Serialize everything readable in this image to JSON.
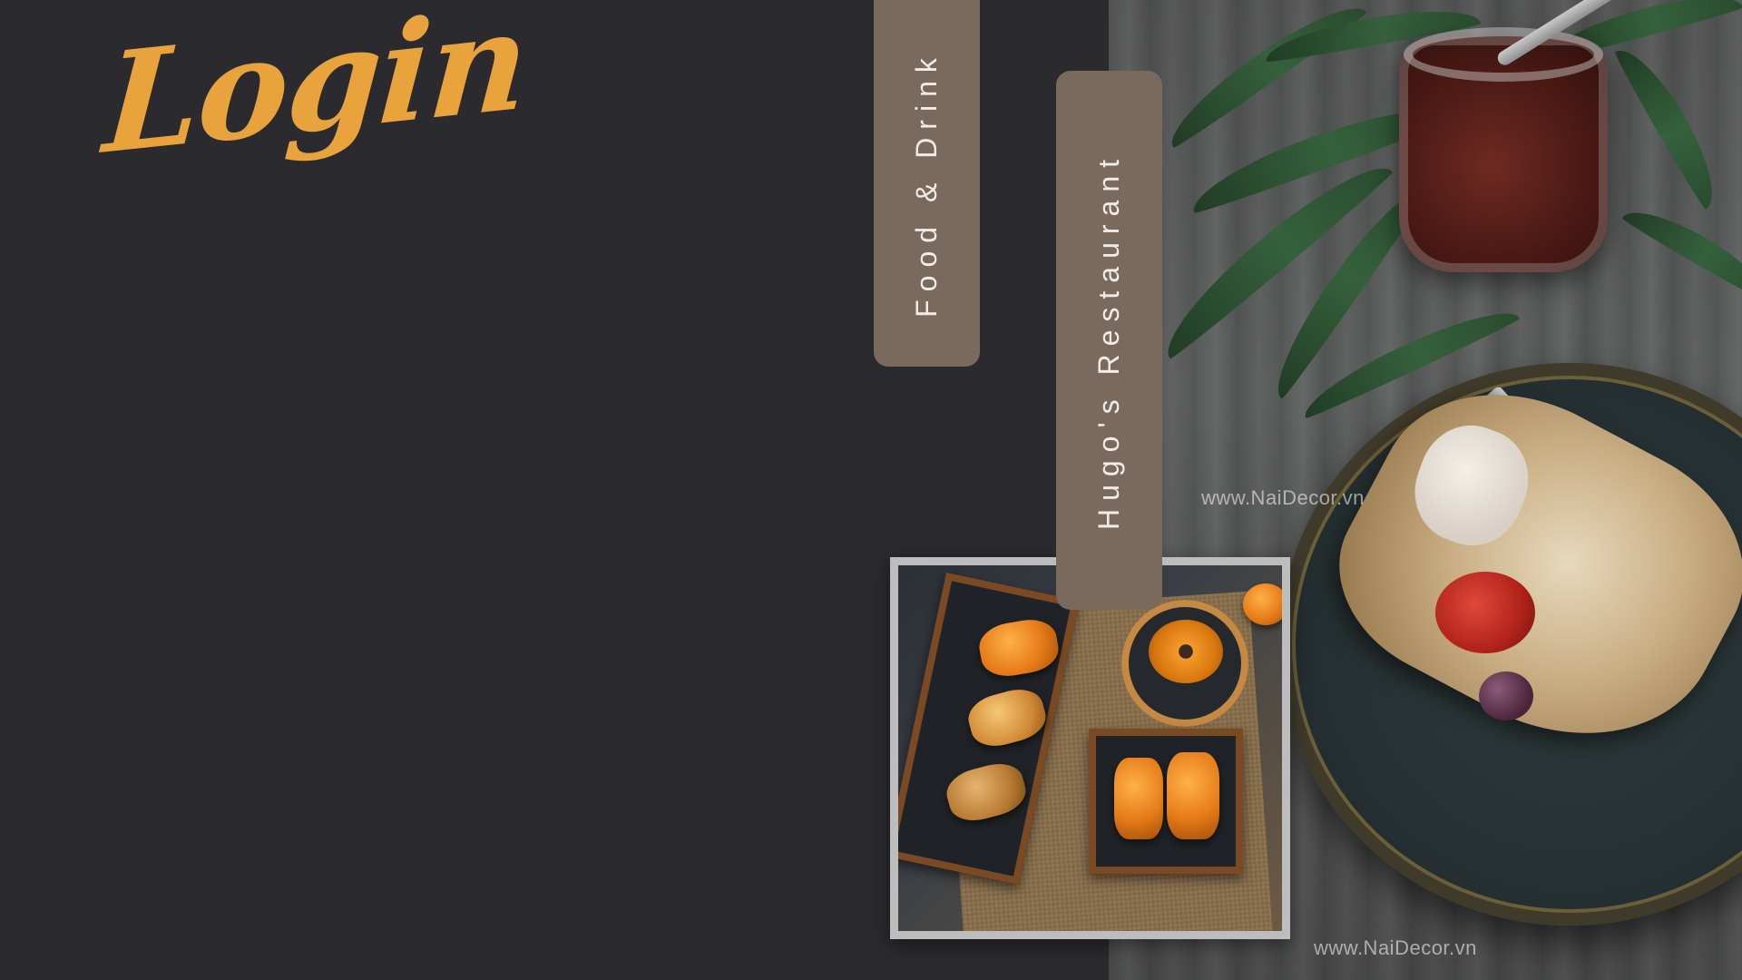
{
  "slide": {
    "title": "Login",
    "tags": {
      "category": "Food & Drink",
      "brand": "Hugo's Restaurant"
    },
    "photo": {
      "watermark_top": "www.NaiDecor.vn",
      "watermark_bottom": "www.NaiDecor.vn"
    }
  },
  "colors": {
    "background": "#2a2a2f",
    "title": "#e8a33c",
    "tag_fill": "#7a6a5e",
    "tag_text": "#f2ece6",
    "frame": "#bdbdbd"
  }
}
